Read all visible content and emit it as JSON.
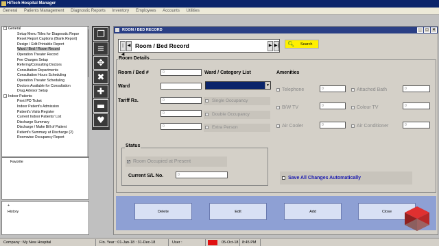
{
  "app": {
    "title": "HiTech Hospital Manager"
  },
  "menu": [
    "General",
    "Patients Management",
    "Diagnostic Reports",
    "Inventory",
    "Employees",
    "Accounts",
    "Utilities"
  ],
  "tree": {
    "items": [
      {
        "label": "General",
        "level": 0,
        "box": "-"
      },
      {
        "label": "Setup Menu Titles for Diagnostic Repor",
        "level": 1
      },
      {
        "label": "Reset Report Captions (Blank Report)",
        "level": 1
      },
      {
        "label": "Design / Edit Printable Report",
        "level": 1
      },
      {
        "label": "Ward / Bed / Room Record",
        "level": 1,
        "selected": true
      },
      {
        "label": "Operation Theater Record",
        "level": 1
      },
      {
        "label": "Fee Charges Setup",
        "level": 1
      },
      {
        "label": "Refering/Consulting Doctors",
        "level": 1
      },
      {
        "label": "Consultation Departments",
        "level": 1
      },
      {
        "label": "Consultation Hours Scheduling",
        "level": 1
      },
      {
        "label": "Operation Theater Scheduling",
        "level": 1
      },
      {
        "label": "Doctors Available for Consultation",
        "level": 1
      },
      {
        "label": "Drug Advisor Setup",
        "level": 1
      },
      {
        "label": "Indoor Patients",
        "level": 0,
        "box": "-"
      },
      {
        "label": "Print IPD Ticket",
        "level": 1
      },
      {
        "label": "Indoor Patient's Admission",
        "level": 1
      },
      {
        "label": "Patient's Visits Register",
        "level": 1
      },
      {
        "label": "Current Indoor Patients' List",
        "level": 1
      },
      {
        "label": "Discharge Summary",
        "level": 1
      },
      {
        "label": "Discharge / Make Bill of Patient",
        "level": 1
      },
      {
        "label": "Patient's Summary at Discharge (2)",
        "level": 1
      },
      {
        "label": "Roomwise Occupancy Report",
        "level": 1
      }
    ],
    "favorite_label": "Favorite",
    "history_label": "History"
  },
  "toolstrip": [
    "copy-icon",
    "list-icon",
    "move-icon",
    "delete-x-icon",
    "add-icon",
    "remove-icon",
    "heart-icon"
  ],
  "form": {
    "title": "ROOM / BED RECORD",
    "nav_title": "Room / Bed Record",
    "search_label": "Search",
    "room_details_legend": "Room Details",
    "labels": {
      "room_bed_no": "Room / Bed #",
      "ward": "Ward",
      "tariff": "Tariff Rs.",
      "ward_category_list": "Ward / Category List",
      "amenities": "Amenities"
    },
    "room_bed_value": "0",
    "tariff_values": [
      "0",
      "0",
      "0"
    ],
    "occupancy_options": [
      "Single Occupancy",
      "Double Occupancy",
      "Extra Person"
    ],
    "amenities_left": [
      {
        "label": "Telephone",
        "value": "0"
      },
      {
        "label": "B/W TV",
        "value": "0"
      },
      {
        "label": "Air Cooler",
        "value": "0"
      }
    ],
    "amenities_right": [
      {
        "label": "Attached Bath",
        "value": "0"
      },
      {
        "label": "Colour TV",
        "value": "0"
      },
      {
        "label": "Air Conditioner",
        "value": "0"
      }
    ],
    "status_legend": "Status",
    "room_occupied_label": "Room Occupied at Present",
    "current_sl_label": "Current S/L No.",
    "current_sl_value": "0",
    "save_all_label": "Save All Changes Automatically",
    "buttons": {
      "delete": "Delete",
      "edit": "Edit",
      "add": "Add",
      "close": "Close"
    }
  },
  "statusbar": {
    "company": "Company : My New Hospital",
    "fin_year": "Fin. Year : 01-Jan-18 : 31-Dec-18",
    "user": "User :",
    "date": "05-Oct-18",
    "time": "8:45 PM"
  }
}
